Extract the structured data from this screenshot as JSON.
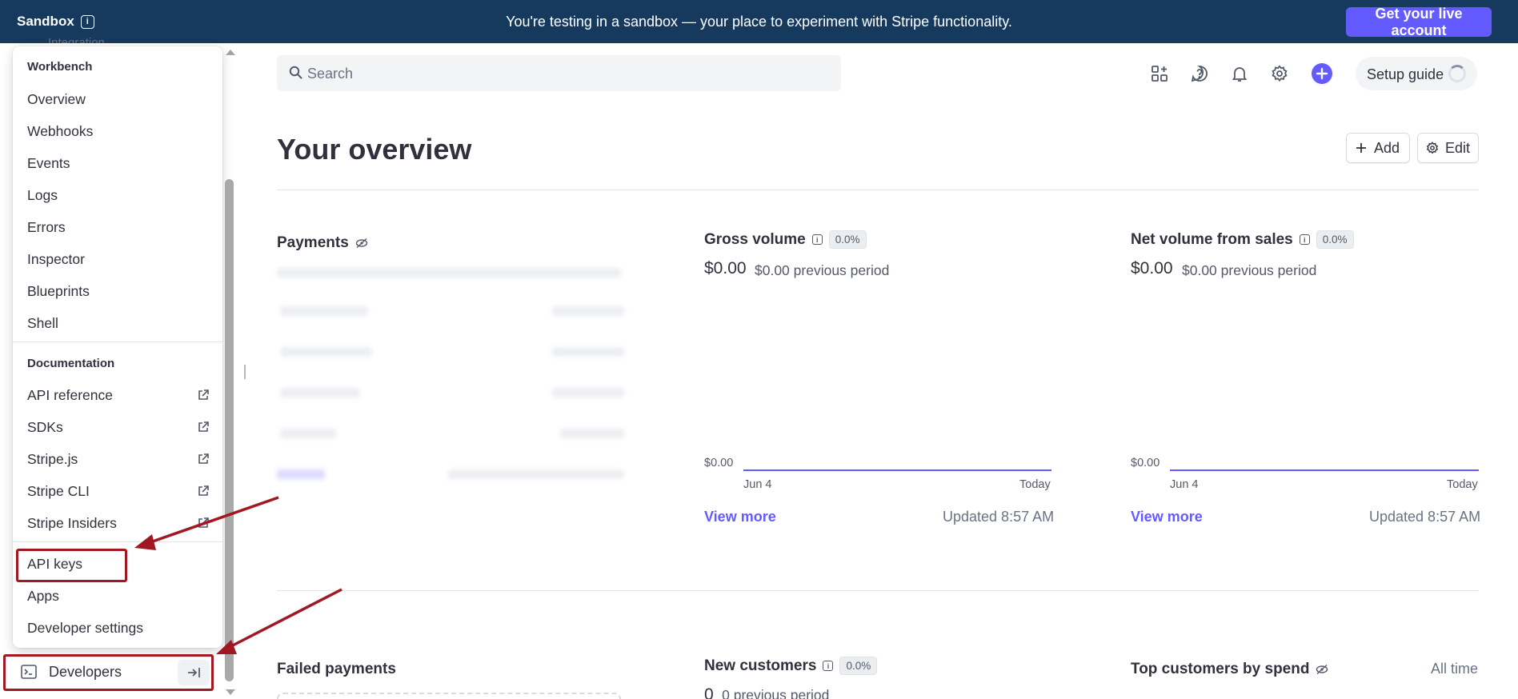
{
  "banner": {
    "sandbox_label": "Sandbox",
    "message": "You're testing in a sandbox — your place to experiment with Stripe functionality.",
    "live_button": "Get your live account",
    "bg_color": "#163a5e",
    "accent_color": "#635bff"
  },
  "menu": {
    "workbench_title": "Workbench",
    "workbench_items": [
      "Overview",
      "Webhooks",
      "Events",
      "Logs",
      "Errors",
      "Inspector",
      "Blueprints",
      "Shell"
    ],
    "documentation_title": "Documentation",
    "documentation_items": [
      "API reference",
      "SDKs",
      "Stripe.js",
      "Stripe CLI",
      "Stripe Insiders"
    ],
    "bottom_items": [
      "API keys",
      "Apps",
      "Developer settings"
    ],
    "developers_label": "Developers"
  },
  "topbar": {
    "search_placeholder": "Search",
    "icons": [
      "apps-icon",
      "help-icon",
      "notifications-icon",
      "settings-icon",
      "create-icon"
    ],
    "setup_guide": "Setup guide"
  },
  "page": {
    "title": "Your overview",
    "add_label": "Add",
    "edit_label": "Edit"
  },
  "widgets": {
    "payments": {
      "title": "Payments"
    },
    "gross_volume": {
      "title": "Gross volume",
      "badge": "0.0%",
      "value": "$0.00",
      "previous": "$0.00 previous period",
      "y_label": "$0.00",
      "x_start": "Jun 4",
      "x_end": "Today",
      "link": "View more",
      "updated": "Updated 8:57 AM"
    },
    "net_volume": {
      "title": "Net volume from sales",
      "badge": "0.0%",
      "value": "$0.00",
      "previous": "$0.00 previous period",
      "y_label": "$0.00",
      "x_start": "Jun 4",
      "x_end": "Today",
      "link": "View more",
      "updated": "Updated 8:57 AM"
    },
    "failed_payments": {
      "title": "Failed payments"
    },
    "new_customers": {
      "title": "New customers",
      "badge": "0.0%",
      "value": "0",
      "previous": "0 previous period"
    },
    "top_customers": {
      "title": "Top customers by spend",
      "range": "All time"
    }
  }
}
